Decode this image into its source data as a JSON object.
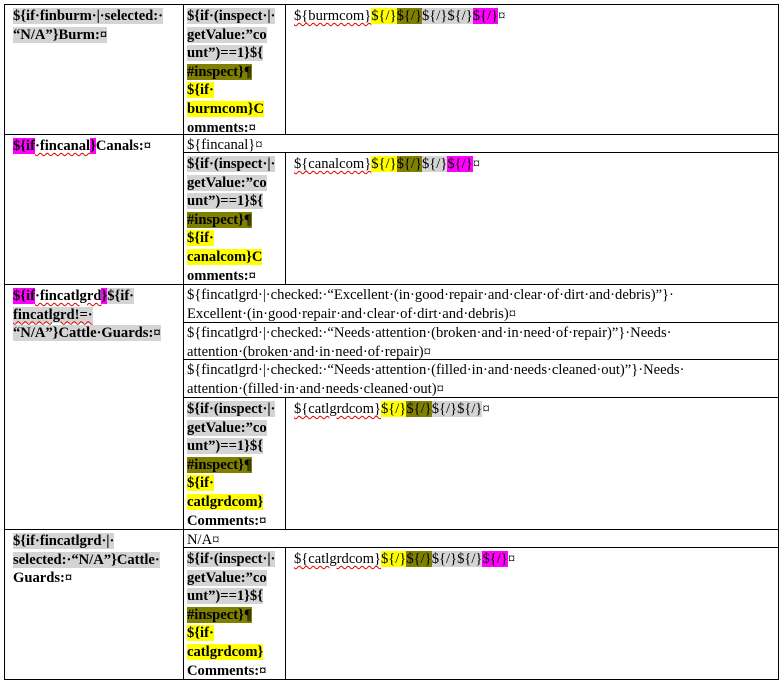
{
  "rows": {
    "burm": {
      "label": [
        "${if·finburm·|·selected:·",
        "“N/A”}Burm:¤"
      ],
      "inspect_block": [
        "${if·(inspect·|·",
        "getValue:”co",
        "unt”)==1}${",
        "#inspect}¶",
        "${if·",
        "burmcom}C",
        "omments:¤"
      ],
      "field": [
        "${burmcom}",
        "${/}",
        "${/}",
        "${/}${/}",
        "${/}",
        "¤"
      ]
    },
    "canal": {
      "label": [
        "${if",
        "·fincanal",
        "}",
        "Canals:¤"
      ],
      "value": "${fincanal}¤",
      "inspect_block": [
        "${if·(inspect·|·",
        "getValue:”co",
        "unt”)==1}${",
        "#inspect}¶",
        "${if·",
        "canalcom}C",
        "omments:¤"
      ],
      "field": [
        "${canalcom}",
        "${/}",
        "${/}",
        "${/}",
        "${/}",
        "¤"
      ]
    },
    "cattle_guards": {
      "label": [
        "${if",
        "·fincatlgrd",
        "}",
        "${if·",
        "fincatlgrd!=·",
        "“N/A”}Cattle·Guards:¤"
      ],
      "options": [
        [
          "${fincatlgrd·|·checked:·“Excellent·(in·good·repair·and·clear·of·dirt·and·debris)”}·",
          "Excellent·(in·good·repair·and·clear·of·dirt·and·debris)¤"
        ],
        [
          "${fincatlgrd·|·checked:·“Needs·attention·(broken·and·in·need·of·repair)”}·Needs·",
          "attention·(broken·and·in·need·of·repair)¤"
        ],
        [
          "${fincatlgrd·|·checked:·“Needs·attention·(filled·in·and·needs·cleaned·out)”}·Needs·",
          "attention·(filled·in·and·needs·cleaned·out)¤"
        ]
      ],
      "inspect_block": [
        "${if·(inspect·|·",
        "getValue:”co",
        "unt”)==1}${",
        "#inspect}¶",
        "${if·",
        "catlgrdcom}",
        "Comments:¤"
      ],
      "field": [
        "${catlgrdcom}",
        "${/}",
        "${/}",
        "${/}${/}",
        "¤"
      ]
    },
    "cattle_guards_na": {
      "label": [
        "${if·fincatlgrd·|·",
        "selected:·“N/A”}Cattle·",
        "Guards:¤"
      ],
      "value": "N/A¤",
      "inspect_block": [
        "${if·(inspect·|·",
        "getValue:”co",
        "unt”)==1}${",
        "#inspect}¶",
        "${if·",
        "catlgrdcom}",
        "Comments:¤"
      ],
      "field": [
        "${catlgrdcom}",
        "${/}",
        "${/}",
        "${/}${/}",
        "${/}",
        "¤"
      ]
    }
  },
  "colors": {
    "gray_highlight": "#d4d4d4",
    "yellow_highlight": "#ffff00",
    "olive_highlight": "#808000",
    "magenta_highlight": "#ff00ff",
    "spell_underline": "#e00000"
  }
}
